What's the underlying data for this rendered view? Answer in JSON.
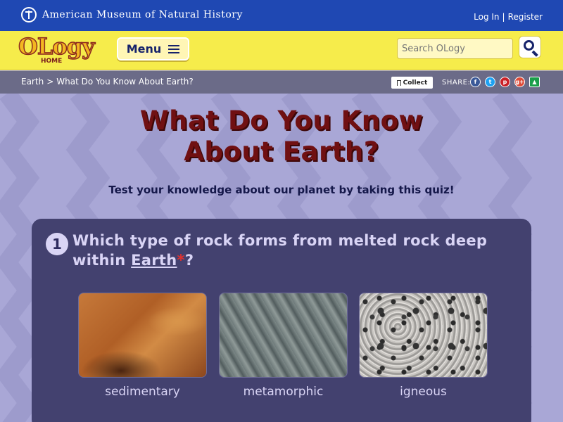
{
  "topbar": {
    "museum_name": "American Museum of Natural History",
    "login_label": "Log In",
    "separator": "|",
    "register_label": "Register"
  },
  "header": {
    "logo_text": "OLogy",
    "logo_home": "HOME",
    "menu_label": "Menu",
    "search_placeholder": "Search OLogy"
  },
  "breadcrumb": {
    "parent": "Earth",
    "separator": ">",
    "current": "What Do You Know About Earth?",
    "collect_label": "Collect",
    "share_label": "SHARE:",
    "share_icons": [
      "facebook-icon",
      "twitter-icon",
      "pinterest-icon",
      "google-plus-icon",
      "classroom-icon"
    ]
  },
  "page": {
    "title_line1": "What Do You Know",
    "title_line2": "About Earth?",
    "subtitle": "Test your knowledge about our planet by taking this quiz!"
  },
  "question": {
    "number": "1",
    "text_before": "Which type of rock forms from melted rock deep within ",
    "glossary_word": "Earth",
    "glossary_marker": "*",
    "text_after": "?",
    "options": [
      {
        "label": "sedimentary"
      },
      {
        "label": "metamorphic"
      },
      {
        "label": "igneous"
      }
    ]
  },
  "colors": {
    "museum_blue": "#1f48b3",
    "ology_yellow": "#f6ec4b",
    "background_purple": "#a9a7d6",
    "card_purple": "#43416f",
    "title_maroon": "#701012"
  }
}
